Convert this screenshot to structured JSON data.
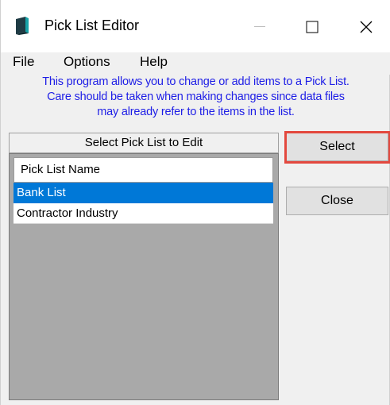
{
  "window": {
    "title": "Pick List Editor"
  },
  "menu": {
    "items": [
      {
        "label": "File"
      },
      {
        "label": "Options"
      },
      {
        "label": "Help"
      }
    ]
  },
  "info": {
    "lines": [
      "This program allows you to change or add items to a Pick List.",
      "Care should be taken when making changes since data files",
      "may already refer to the items in the list."
    ],
    "color": "#1e1ee6"
  },
  "list": {
    "header": "Select Pick List to Edit",
    "column_header": "Pick List Name",
    "rows": [
      {
        "label": "Bank List",
        "selected": true
      },
      {
        "label": "Contractor Industry",
        "selected": false
      }
    ],
    "selection_color": "#0078d7"
  },
  "buttons": {
    "select_label": "Select",
    "close_label": "Close",
    "highlight_color": "#e3483e"
  },
  "icons": {
    "app": "book-icon",
    "minimize": "minimize-icon",
    "maximize": "maximize-icon",
    "close": "close-icon"
  }
}
